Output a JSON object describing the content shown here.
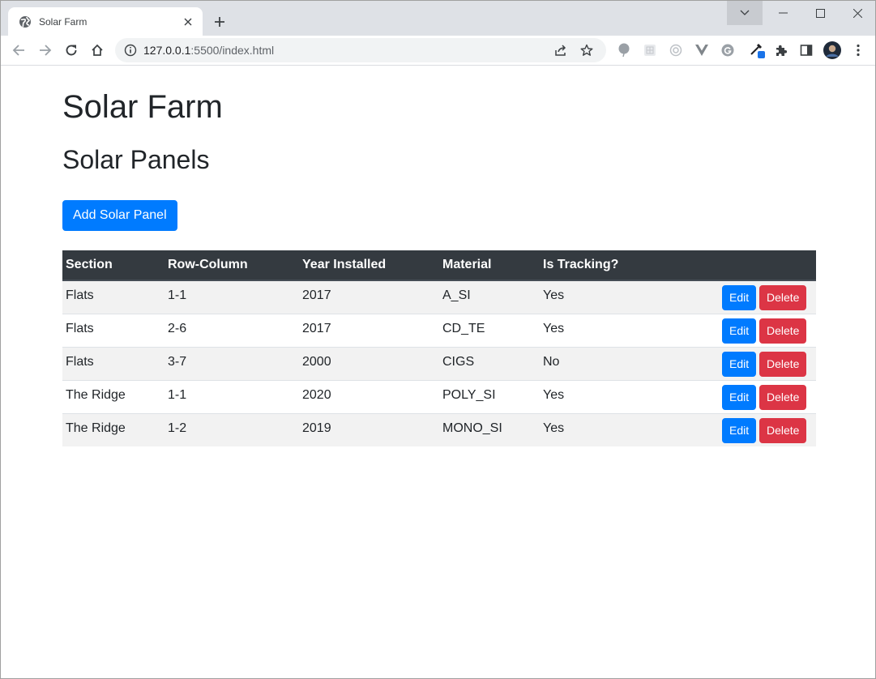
{
  "browser": {
    "tab_title": "Solar Farm",
    "url_host": "127.0.0.1",
    "url_rest": ":5500/index.html",
    "icons": [
      "globe-icon",
      "close-icon",
      "plus-icon",
      "chevron-down-icon",
      "minimize-icon",
      "maximize-icon",
      "window-close-icon",
      "back-arrow-icon",
      "forward-arrow-icon",
      "reload-icon",
      "home-icon",
      "info-icon",
      "share-icon",
      "star-icon",
      "extension-icons",
      "puzzle-icon",
      "sidebar-icon",
      "avatar",
      "kebab-menu-icon"
    ]
  },
  "page": {
    "heading": "Solar Farm",
    "subheading": "Solar Panels",
    "add_button_label": "Add Solar Panel",
    "table": {
      "headers": [
        "Section",
        "Row-Column",
        "Year Installed",
        "Material",
        "Is Tracking?",
        ""
      ],
      "rows": [
        {
          "section": "Flats",
          "row_column": "1-1",
          "year": "2017",
          "material": "A_SI",
          "tracking": "Yes"
        },
        {
          "section": "Flats",
          "row_column": "2-6",
          "year": "2017",
          "material": "CD_TE",
          "tracking": "Yes"
        },
        {
          "section": "Flats",
          "row_column": "3-7",
          "year": "2000",
          "material": "CIGS",
          "tracking": "No"
        },
        {
          "section": "The Ridge",
          "row_column": "1-1",
          "year": "2020",
          "material": "POLY_SI",
          "tracking": "Yes"
        },
        {
          "section": "The Ridge",
          "row_column": "1-2",
          "year": "2019",
          "material": "MONO_SI",
          "tracking": "Yes"
        }
      ],
      "edit_label": "Edit",
      "delete_label": "Delete"
    }
  },
  "colors": {
    "primary": "#007bff",
    "danger": "#dc3545",
    "table_header": "#343a40",
    "stripe": "#f2f2f2"
  }
}
